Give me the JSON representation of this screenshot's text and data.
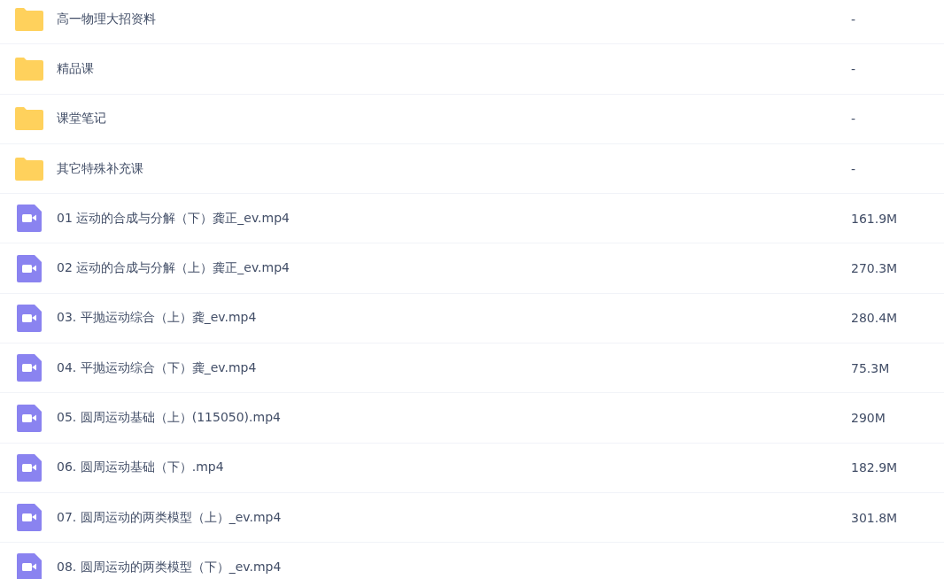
{
  "files": [
    {
      "kind": "folder",
      "name": "高一物理大招资料",
      "size": "-"
    },
    {
      "kind": "folder",
      "name": "精品课",
      "size": "-"
    },
    {
      "kind": "folder",
      "name": "课堂笔记",
      "size": "-"
    },
    {
      "kind": "folder",
      "name": "其它特殊补充课",
      "size": "-"
    },
    {
      "kind": "video",
      "name": "01 运动的合成与分解（下）龚正_ev.mp4",
      "size": "161.9M"
    },
    {
      "kind": "video",
      "name": "02 运动的合成与分解（上）龚正_ev.mp4",
      "size": "270.3M"
    },
    {
      "kind": "video",
      "name": "03. 平抛运动综合（上）龚_ev.mp4",
      "size": "280.4M"
    },
    {
      "kind": "video",
      "name": "04. 平抛运动综合（下）龚_ev.mp4",
      "size": "75.3M"
    },
    {
      "kind": "video",
      "name": "05. 圆周运动基础（上）(115050).mp4",
      "size": "290M"
    },
    {
      "kind": "video",
      "name": "06. 圆周运动基础（下）.mp4",
      "size": "182.9M"
    },
    {
      "kind": "video",
      "name": "07. 圆周运动的两类模型（上）_ev.mp4",
      "size": "301.8M"
    },
    {
      "kind": "video",
      "name": "08. 圆周运动的两类模型（下）_ev.mp4"
    }
  ]
}
